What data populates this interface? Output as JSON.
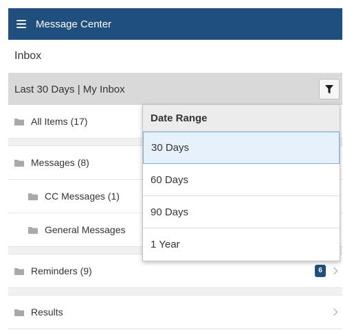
{
  "header": {
    "title": "Message Center",
    "menu_icon": "hamburger-menu-icon",
    "background": "#1f4f7d"
  },
  "inbox": {
    "label": "Inbox"
  },
  "filter": {
    "label": "Last 30 Days | My Inbox",
    "button_icon": "filter-funnel-icon"
  },
  "folders": [
    {
      "label": "All Items (17)",
      "icon": "folder-icon"
    },
    {
      "label": "Messages (8)",
      "icon": "folder-icon"
    },
    {
      "label": "CC Messages (1)",
      "icon": "folder-icon"
    },
    {
      "label": "General Messages",
      "icon": "folder-icon"
    },
    {
      "label": "Reminders (9)",
      "icon": "folder-icon",
      "badge": "6"
    },
    {
      "label": "Results",
      "icon": "folder-icon"
    }
  ],
  "date_range_menu": {
    "title": "Date Range",
    "options": [
      {
        "label": "30 Days",
        "selected": true
      },
      {
        "label": "60 Days",
        "selected": false
      },
      {
        "label": "90 Days",
        "selected": false
      },
      {
        "label": "1 Year",
        "selected": false
      }
    ]
  },
  "colors": {
    "accent": "#1f4f7d",
    "selected_option": "#e6f1fb",
    "selected_border": "#7fb2e0"
  }
}
